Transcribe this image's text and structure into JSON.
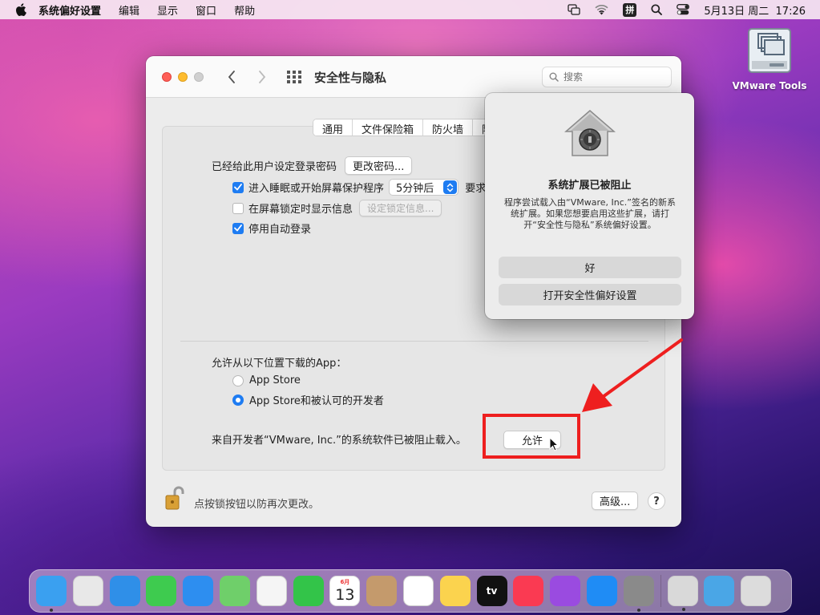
{
  "menubar": {
    "apple_icon": "apple-logo",
    "app_name": "系统偏好设置",
    "items": [
      "编辑",
      "显示",
      "窗口",
      "帮助"
    ],
    "ime": "拼",
    "datetime": "5月13日 周二  17:26"
  },
  "desktop": {
    "icon_label": "VMware Tools"
  },
  "window": {
    "title": "安全性与隐私",
    "search_placeholder": "搜索",
    "tabs": [
      "通用",
      "文件保险箱",
      "防火墙",
      "隐私"
    ],
    "active_tab": "通用",
    "password_label": "已经给此用户设定登录密码",
    "change_password_button": "更改密码...",
    "require_password_label": "进入睡眠或开始屏幕保护程序",
    "require_password_checked": true,
    "delay_select_value": "5分钟后",
    "require_suffix": "要求",
    "lock_message_label": "在屏幕锁定时显示信息",
    "lock_message_checked": false,
    "lock_message_button": "设定锁定信息...",
    "auto_login_label": "停用自动登录",
    "auto_login_checked": true,
    "download_heading": "允许从以下位置下载的App：",
    "radio_options": [
      "App Store",
      "App Store和被认可的开发者"
    ],
    "radio_selected_index": 1,
    "blocked_message": "来自开发者“VMware, Inc.”的系统软件已被阻止载入。",
    "allow_button": "允许",
    "lock_footer_text": "点按锁按钮以防再次更改。",
    "advanced_button": "高级...",
    "help_button": "?"
  },
  "alert": {
    "title": "系统扩展已被阻止",
    "message": "程序尝试载入由“VMware, Inc.”签名的新系统扩展。如果您想要启用这些扩展，请打开“安全性与隐私”系统偏好设置。",
    "ok_button": "好",
    "open_prefs_button": "打开安全性偏好设置"
  },
  "dock": {
    "items": [
      {
        "name": "finder",
        "label": "",
        "color": "#3aa0f0"
      },
      {
        "name": "launchpad",
        "label": "",
        "color": "#e8e8e8"
      },
      {
        "name": "safari",
        "label": "",
        "color": "#2f8fe8"
      },
      {
        "name": "messages",
        "label": "",
        "color": "#3ecb4f"
      },
      {
        "name": "mail",
        "label": "",
        "color": "#2d8ef0"
      },
      {
        "name": "maps",
        "label": "",
        "color": "#6fcf6a"
      },
      {
        "name": "photos",
        "label": "",
        "color": "#f5f5f5"
      },
      {
        "name": "facetime",
        "label": "",
        "color": "#33c449"
      },
      {
        "name": "calendar",
        "label": "13",
        "month": "6月",
        "color": "#ffffff"
      },
      {
        "name": "contacts",
        "label": "",
        "color": "#c49a6c"
      },
      {
        "name": "reminders",
        "label": "",
        "color": "#ffffff"
      },
      {
        "name": "notes",
        "label": "",
        "color": "#fbd34e"
      },
      {
        "name": "tv",
        "label": "tv",
        "color": "#111111"
      },
      {
        "name": "music",
        "label": "",
        "color": "#fa3a52"
      },
      {
        "name": "podcasts",
        "label": "",
        "color": "#9a4be0"
      },
      {
        "name": "app-store",
        "label": "",
        "color": "#1f8cf5"
      },
      {
        "name": "system-preferences",
        "label": "",
        "color": "#8a8a8a"
      }
    ],
    "right_items": [
      {
        "name": "installer",
        "label": "",
        "color": "#d9d9d9"
      },
      {
        "name": "downloads-folder",
        "label": "",
        "color": "#4aa6e6"
      },
      {
        "name": "trash",
        "label": "",
        "color": "#dcdcdc"
      }
    ]
  }
}
